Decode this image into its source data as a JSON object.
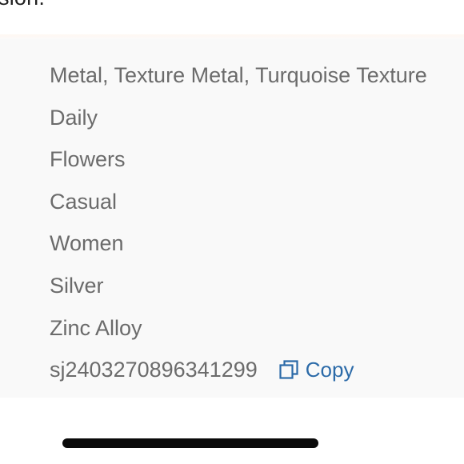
{
  "header": {
    "partial_text": "sion."
  },
  "attributes": [
    {
      "value": "Metal, Texture Metal, Turquoise Texture"
    },
    {
      "value": "Daily"
    },
    {
      "value": "Flowers"
    },
    {
      "value": "Casual"
    },
    {
      "value": "Women"
    },
    {
      "value": "Silver"
    },
    {
      "value": "Zinc Alloy"
    }
  ],
  "sku": {
    "value": "sj2403270896341299",
    "copy_label": "Copy",
    "copy_icon": "copy-icon"
  },
  "colors": {
    "panel_bg": "#f9f9f9",
    "attr_text": "#6b6b6b",
    "link": "#2b6aa8"
  }
}
